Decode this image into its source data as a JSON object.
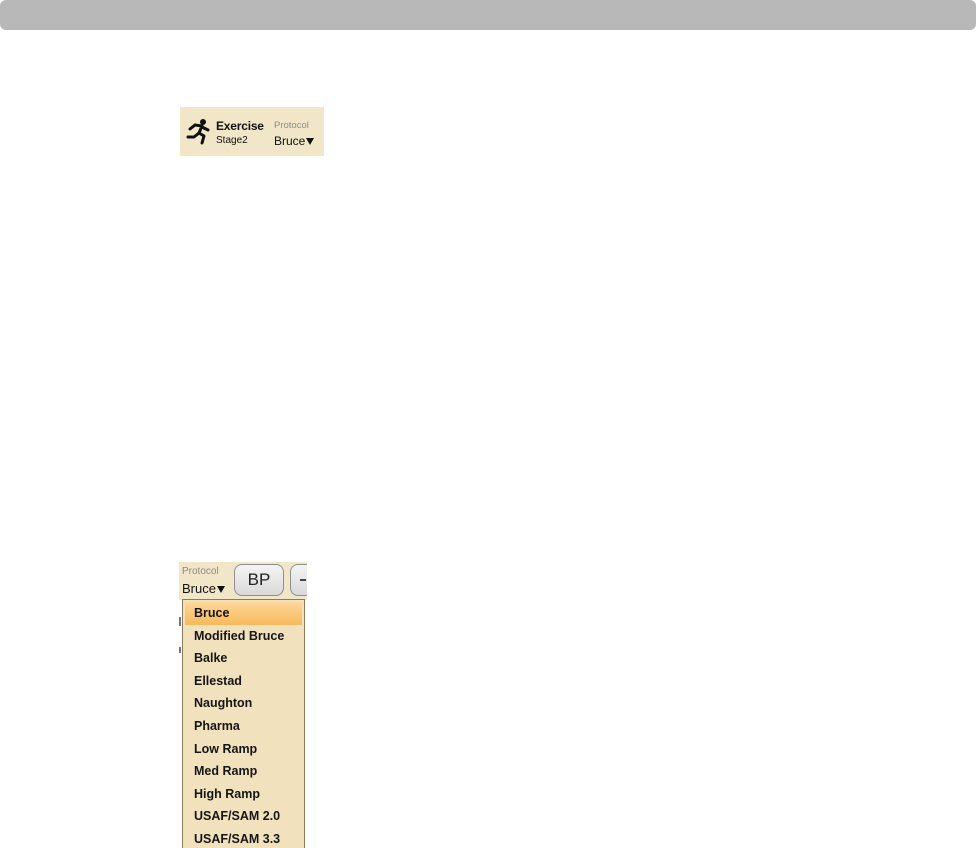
{
  "exercise_panel": {
    "mode": "Exercise",
    "stage": "Stage2",
    "protocol_caption": "Protocol",
    "protocol_value": "Bruce",
    "icon": "runner-icon"
  },
  "protocol_menu": {
    "caption": "Protocol",
    "value": "Bruce",
    "bp_button": "BP",
    "selected_index": 0,
    "options": [
      "Bruce",
      "Modified Bruce",
      "Balke",
      "Ellestad",
      "Naughton",
      "Pharma",
      "Low Ramp",
      "Med Ramp",
      "High Ramp",
      "USAF/SAM 2.0",
      "USAF/SAM 3.3"
    ]
  },
  "colors": {
    "panel_bg": "#f2e6c8",
    "menu_bg": "#f2e1bd",
    "selected": "#f7b95a",
    "top_bar": "#b8b8b8"
  }
}
